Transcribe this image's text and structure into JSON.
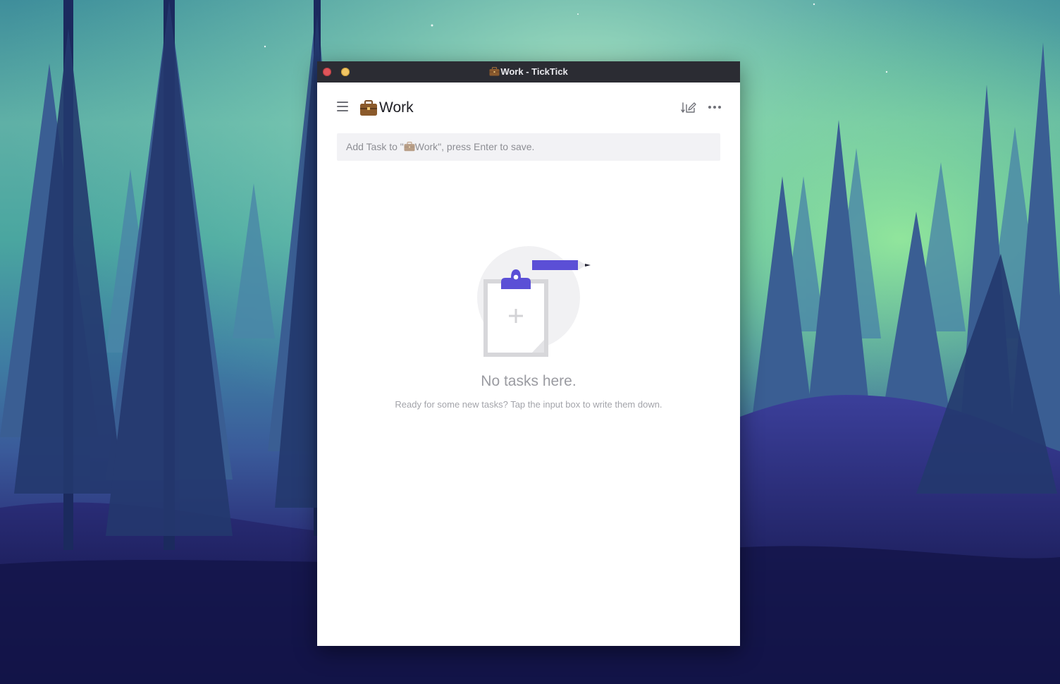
{
  "window": {
    "title": "Work - TickTick",
    "title_icon": "briefcase-icon"
  },
  "header": {
    "menu_icon": "hamburger-menu-icon",
    "list_icon": "briefcase-icon",
    "list_name": "Work",
    "sort_icon": "sort-edit-icon",
    "more_icon": "more-horizontal-icon"
  },
  "add_task": {
    "placeholder_prefix": "Add Task to \"",
    "placeholder_list": "Work",
    "placeholder_suffix": "\", press Enter to save."
  },
  "empty_state": {
    "illustration": "clipboard-pencil-illustration",
    "title": "No tasks here.",
    "subtitle": "Ready for some new tasks? Tap the input box to write them down."
  },
  "colors": {
    "accent": "#5b4fd6",
    "titlebar": "#2b2c33",
    "close_button": "#e0555a",
    "minimize_button": "#f1c564"
  }
}
